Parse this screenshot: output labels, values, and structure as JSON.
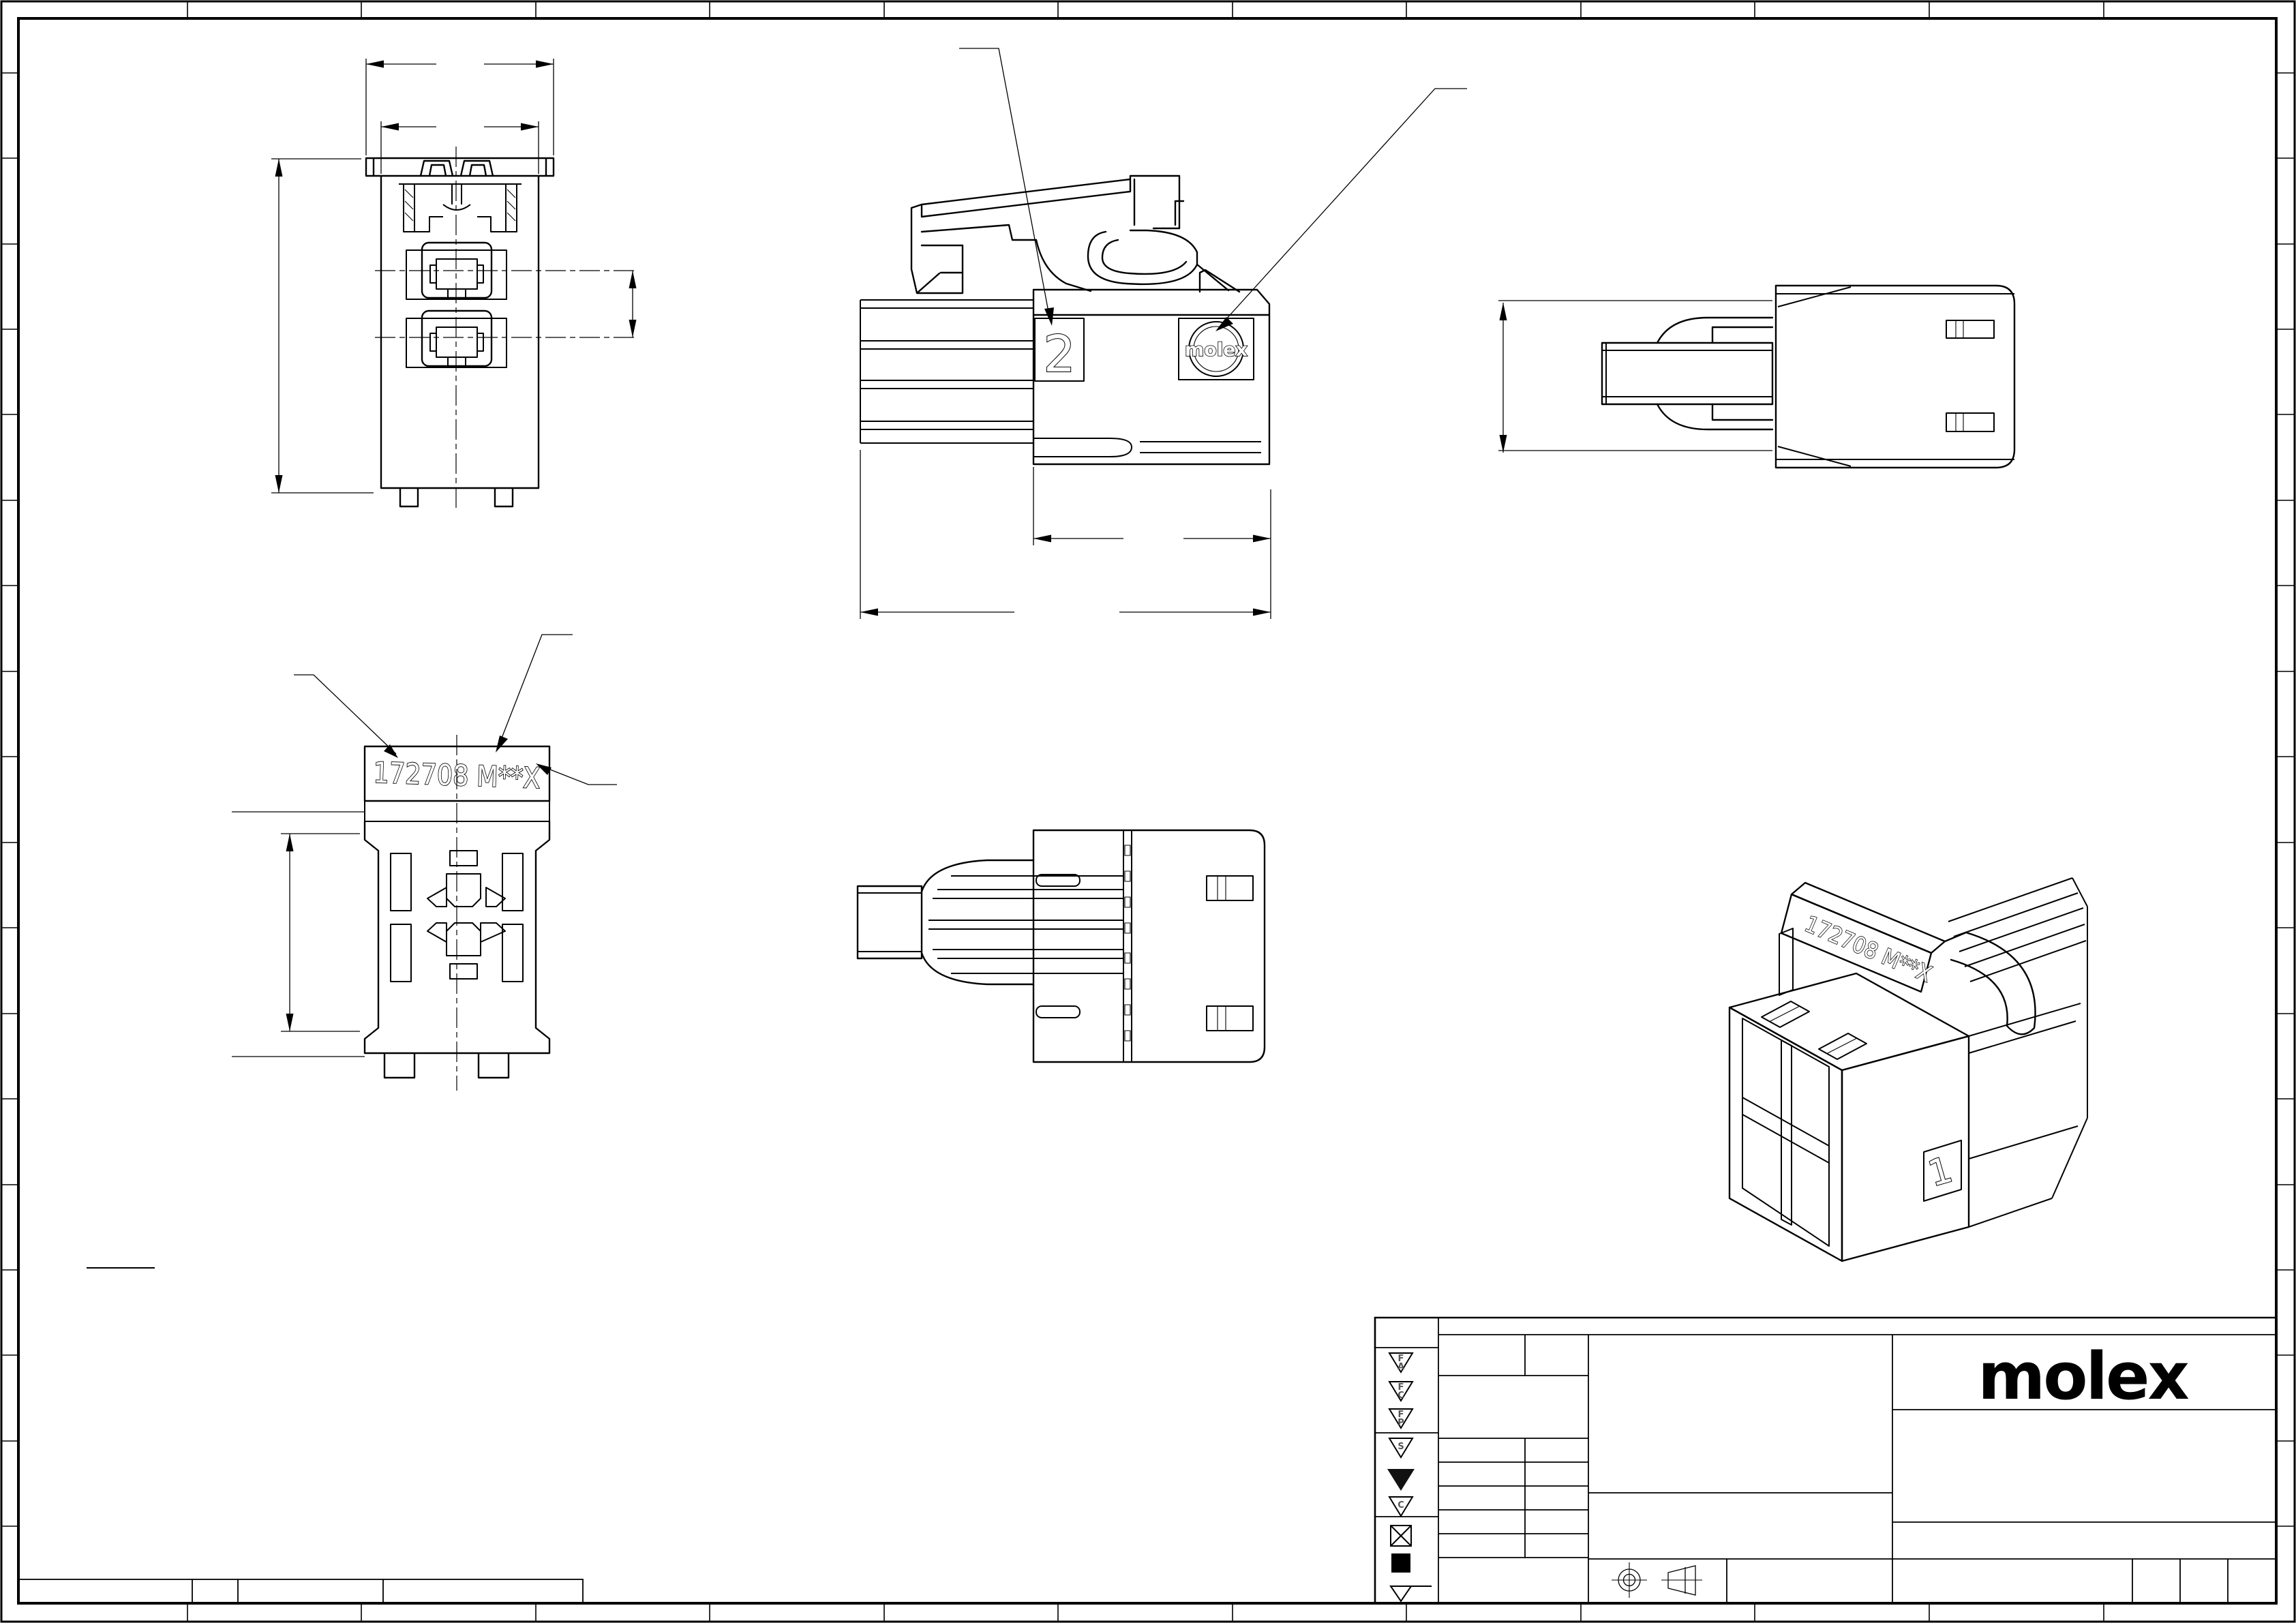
{
  "document": {
    "kind": "connector engineering drawing"
  },
  "title_block": {
    "logo": "molex",
    "revision_symbols": [
      {
        "shape": "triangle",
        "line1": "F",
        "line2": "A"
      },
      {
        "shape": "triangle",
        "line1": "F",
        "line2": "C"
      },
      {
        "shape": "triangle",
        "line1": "F",
        "line2": "P"
      },
      {
        "shape": "triangle",
        "line1": "S",
        "line2": ""
      },
      {
        "shape": "triangle-solid",
        "line1": "",
        "line2": ""
      },
      {
        "shape": "triangle",
        "line1": "C",
        "line2": ""
      },
      {
        "shape": "box-x",
        "line1": "",
        "line2": ""
      },
      {
        "shape": "square-solid",
        "line1": "",
        "line2": ""
      },
      {
        "shape": "triangle-bar",
        "line1": "",
        "line2": ""
      }
    ]
  },
  "views": {
    "side_view": {
      "cavity_number": "2",
      "logo_marking": "molex"
    },
    "front_view": {
      "marking": "172708 M**X"
    },
    "isometric_view": {
      "marking": "172708 M**X",
      "cavity_number": "1"
    }
  }
}
